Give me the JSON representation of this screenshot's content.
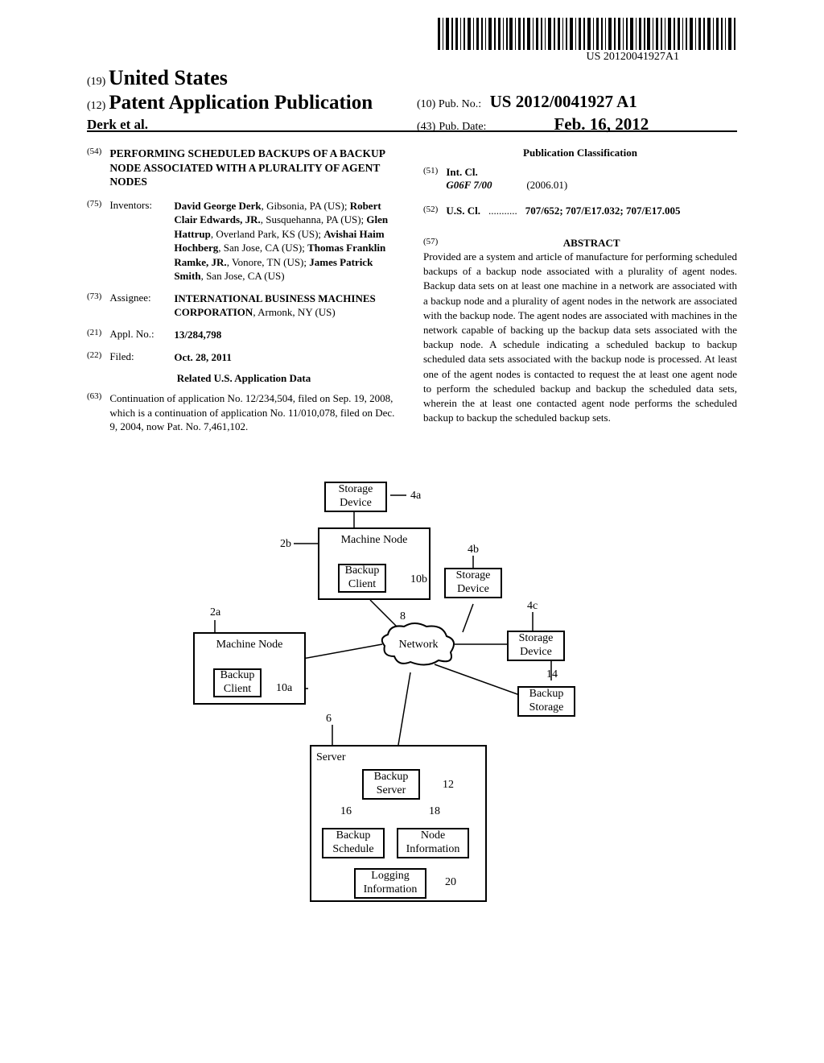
{
  "barcode_number": "US 20120041927A1",
  "header": {
    "country_code": "(19)",
    "country": "United States",
    "pub_code": "(12)",
    "pub_title": "Patent Application Publication",
    "authors": "Derk et al.",
    "pub_no_code": "(10)",
    "pub_no_label": "Pub. No.:",
    "pub_no_val": "US 2012/0041927 A1",
    "pub_date_code": "(43)",
    "pub_date_label": "Pub. Date:",
    "pub_date_val": "Feb. 16, 2012"
  },
  "left": {
    "f54": "(54)",
    "title": "PERFORMING SCHEDULED BACKUPS OF A BACKUP NODE ASSOCIATED WITH A PLURALITY OF AGENT NODES",
    "f75": "(75)",
    "inventors_label": "Inventors:",
    "inventors": "David George Derk, Gibsonia, PA (US); Robert Clair Edwards, JR., Susquehanna, PA (US); Glen Hattrup, Overland Park, KS (US); Avishai Haim Hochberg, San Jose, CA (US); Thomas Franklin Ramke, JR., Vonore, TN (US); James Patrick Smith, San Jose, CA (US)",
    "f73": "(73)",
    "assignee_label": "Assignee:",
    "assignee": "INTERNATIONAL BUSINESS MACHINES CORPORATION, Armonk, NY (US)",
    "f21": "(21)",
    "appl_label": "Appl. No.:",
    "appl_no": "13/284,798",
    "f22": "(22)",
    "filed_label": "Filed:",
    "filed": "Oct. 28, 2011",
    "related_hdr": "Related U.S. Application Data",
    "f63": "(63)",
    "related": "Continuation of application No. 12/234,504, filed on Sep. 19, 2008, which is a continuation of application No. 11/010,078, filed on Dec. 9, 2004, now Pat. No. 7,461,102."
  },
  "right": {
    "class_hdr": "Publication Classification",
    "f51": "(51)",
    "intcl_label": "Int. Cl.",
    "intcl_code": "G06F 7/00",
    "intcl_year": "(2006.01)",
    "f52": "(52)",
    "uscl_label": "U.S. Cl.",
    "uscl_dots": "...........",
    "uscl_val": "707/652; 707/E17.032; 707/E17.005",
    "f57": "(57)",
    "abstract_hdr": "ABSTRACT",
    "abstract": "Provided are a system and article of manufacture for performing scheduled backups of a backup node associated with a plurality of agent nodes. Backup data sets on at least one machine in a network are associated with a backup node and a plurality of agent nodes in the network are associated with the backup node. The agent nodes are associated with machines in the network capable of backing up the backup data sets associated with the backup node. A schedule indicating a scheduled backup to backup scheduled data sets associated with the backup node is processed. At least one of the agent nodes is contacted to request the at least one agent node to perform the scheduled backup and backup the scheduled data sets, wherein the at least one contacted agent node performs the scheduled backup to backup the scheduled backup sets."
  },
  "diagram": {
    "storage_device_4a": "Storage Device",
    "machine_node_2b": "Machine Node",
    "backup_client_10b": "Backup Client",
    "storage_device_4b": "Storage Device",
    "machine_node_2a": "Machine Node",
    "backup_client_10a": "Backup Client",
    "network_8": "Network",
    "storage_device_4c": "Storage Device",
    "backup_storage_14": "Backup Storage",
    "server_6": "Server",
    "backup_server_12": "Backup Server",
    "backup_schedule_16": "Backup Schedule",
    "node_info_18": "Node Information",
    "logging_info_20": "Logging Information",
    "lbl_4a": "4a",
    "lbl_2b": "2b",
    "lbl_10b": "10b",
    "lbl_4b": "4b",
    "lbl_2a": "2a",
    "lbl_10a": "10a",
    "lbl_8": "8",
    "lbl_4c": "4c",
    "lbl_14": "14",
    "lbl_6": "6",
    "lbl_12": "12",
    "lbl_16": "16",
    "lbl_18": "18",
    "lbl_20": "20"
  }
}
